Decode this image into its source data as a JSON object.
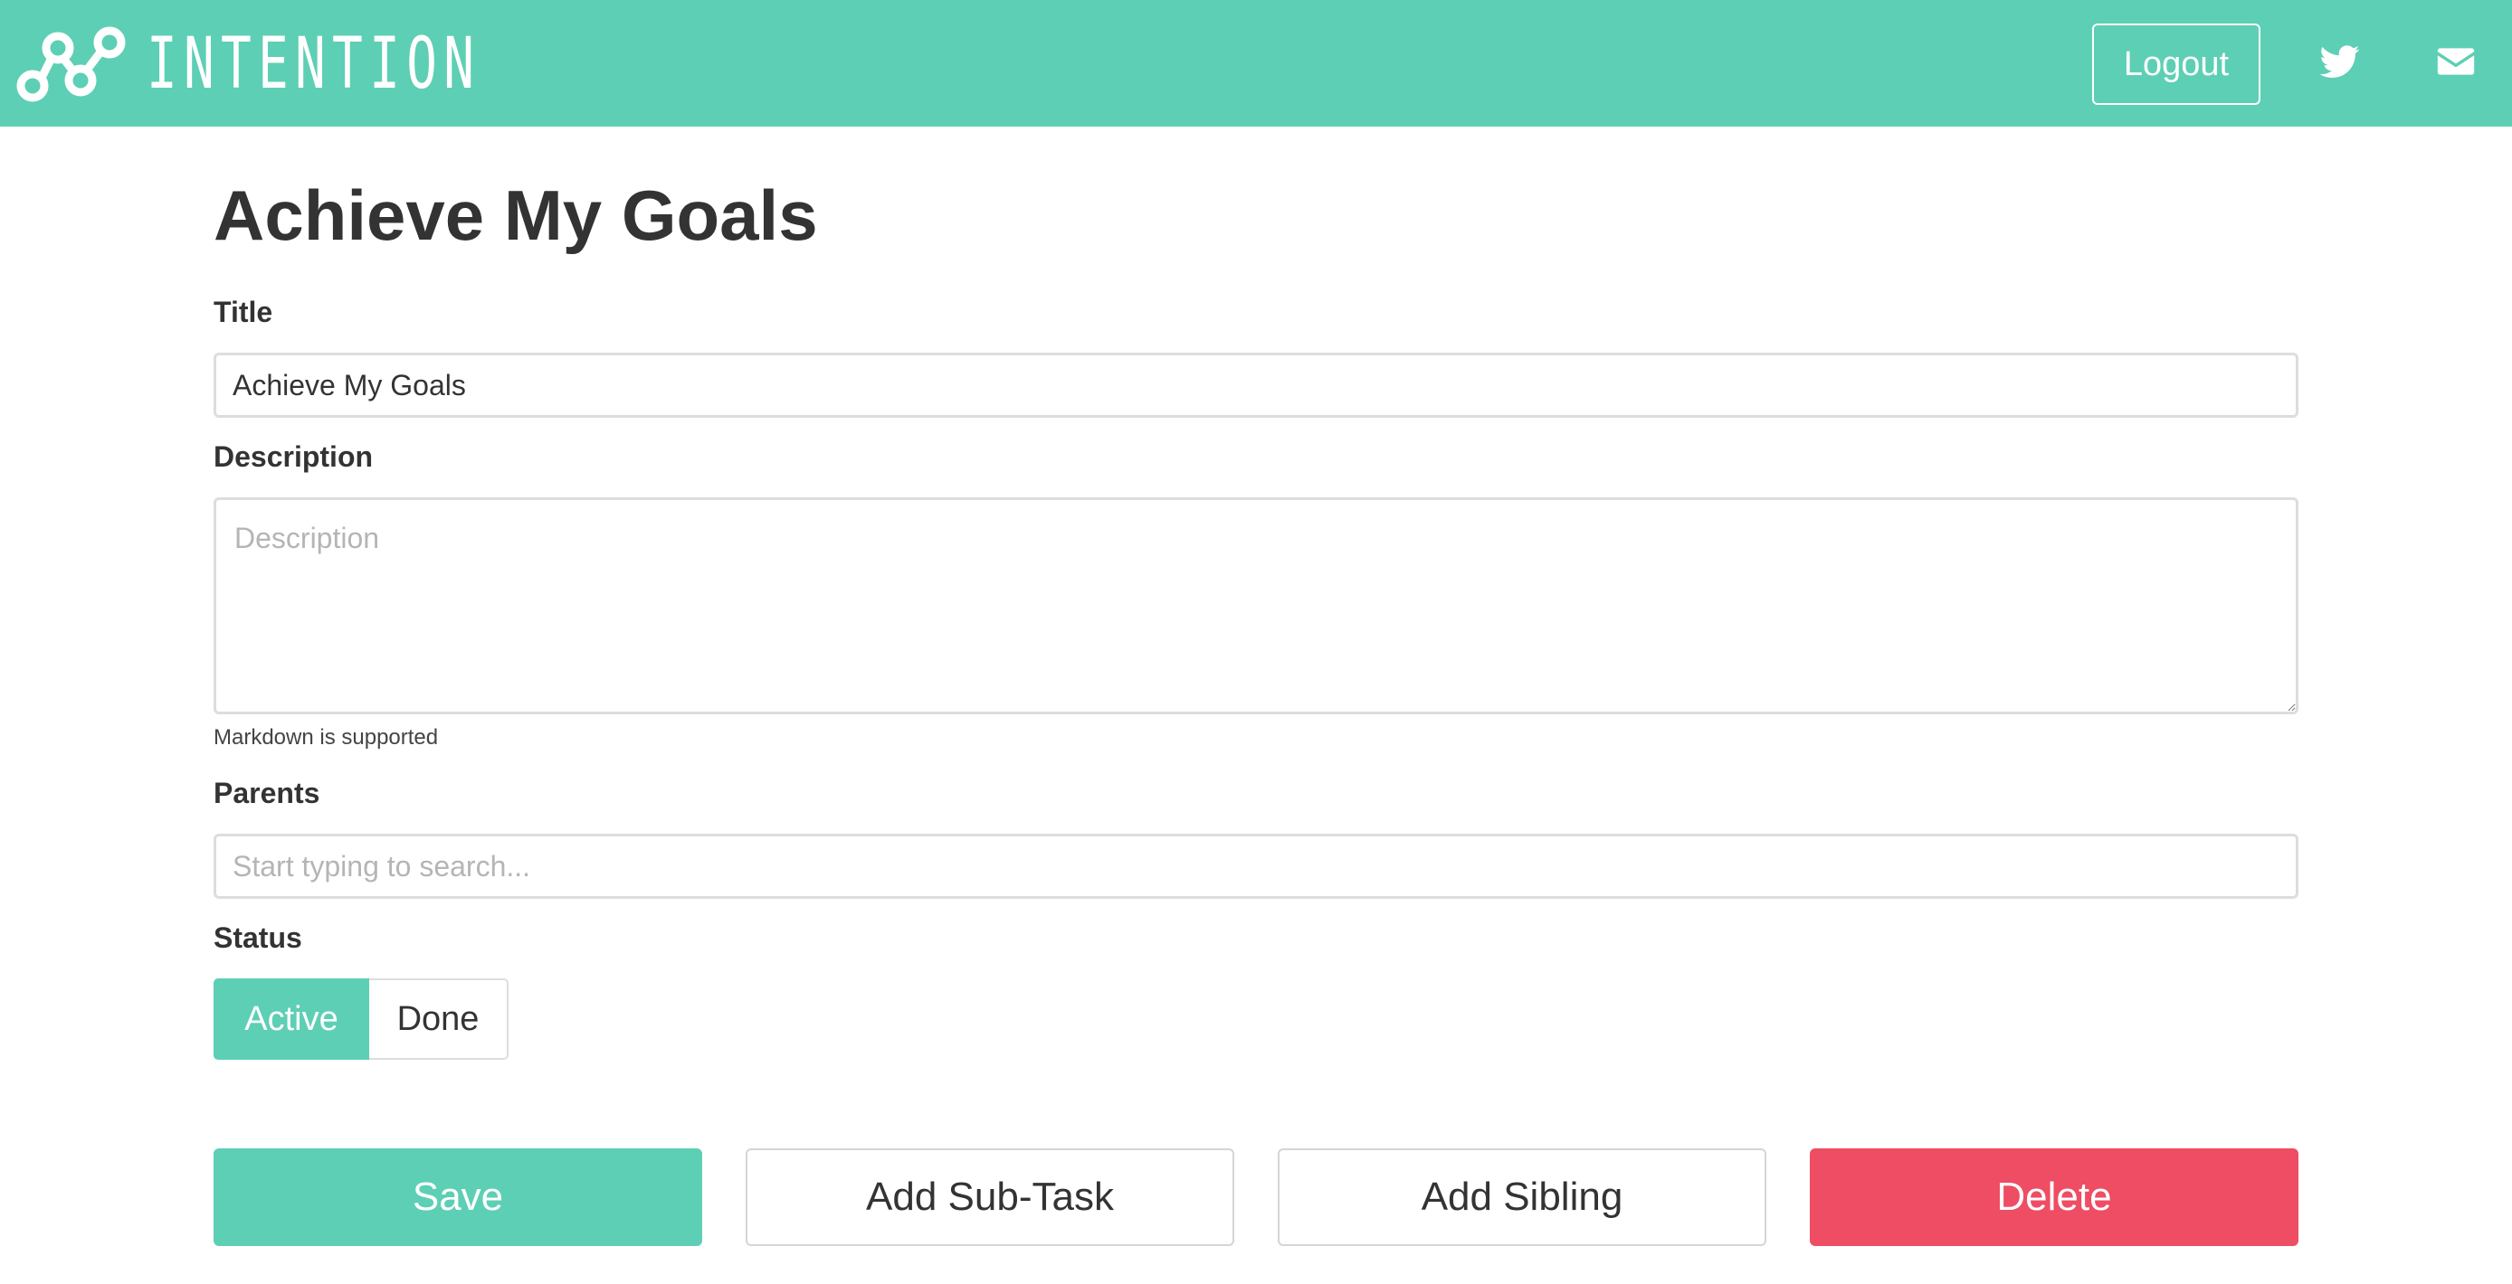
{
  "navbar": {
    "brand": "INTENTION",
    "logo_icon": "connected-nodes-icon",
    "logout_label": "Logout",
    "icons": [
      "twitter-icon",
      "envelope-icon"
    ],
    "background_color": "#5dcfb4"
  },
  "page": {
    "title": "Achieve My Goals"
  },
  "form": {
    "title_label": "Title",
    "title_value": "Achieve My Goals",
    "description_label": "Description",
    "description_value": "",
    "description_placeholder": "Description",
    "description_help": "Markdown is supported",
    "parents_label": "Parents",
    "parents_value": "",
    "parents_placeholder": "Start typing to search...",
    "status_label": "Status",
    "status_options": [
      "Active",
      "Done"
    ],
    "status_selected": "Active"
  },
  "actions": {
    "save_label": "Save",
    "add_subtask_label": "Add Sub-Task",
    "add_sibling_label": "Add Sibling",
    "delete_label": "Delete"
  },
  "colors": {
    "accent": "#5dcfb4",
    "danger": "#ee4d64",
    "text": "#333333"
  }
}
